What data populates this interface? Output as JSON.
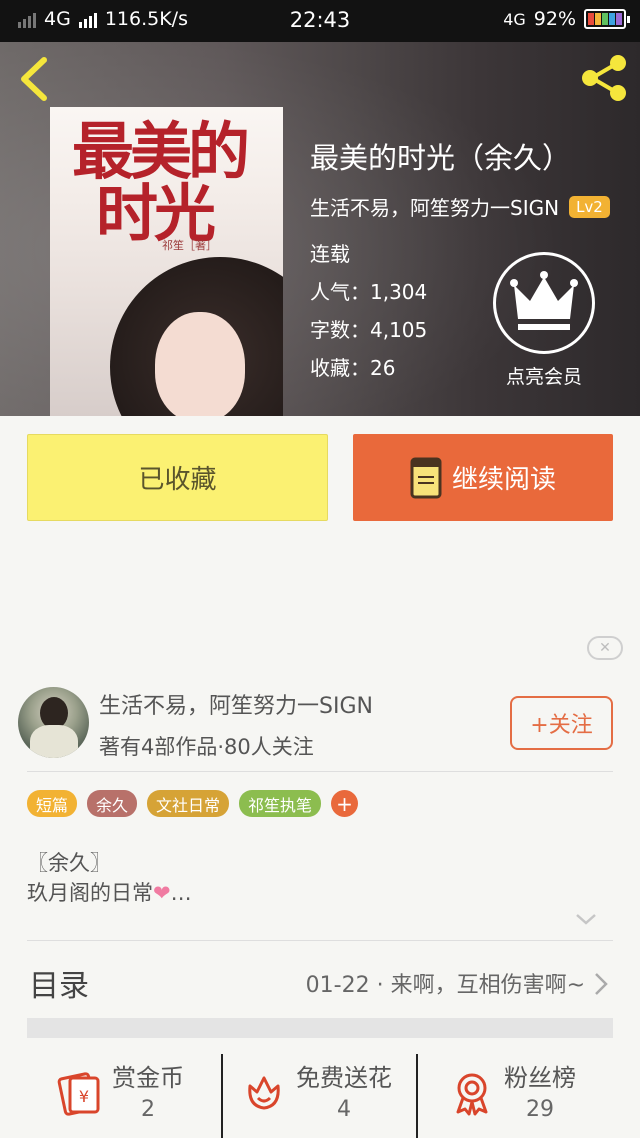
{
  "status_bar": {
    "network": "4G",
    "speed": "116.5K/s",
    "time": "22:43",
    "network_right": "4G",
    "battery": "92%"
  },
  "book": {
    "title": "最美的时光（余久）",
    "author": "生活不易，阿笙努力一SIGN",
    "level": "Lv2",
    "status": "连载",
    "popularity": "人气：1,304",
    "word_count": "字数：4,105",
    "favorites": "收藏：26",
    "cover": {
      "title_line1": "最美的",
      "title_line2": "时光",
      "author": "祁笙［著］"
    }
  },
  "vip": {
    "label": "点亮会员"
  },
  "actions": {
    "favorited_label": "已收藏",
    "continue_label": "继续阅读"
  },
  "author_card": {
    "name": "生活不易，阿笙努力一SIGN",
    "stats": "著有4部作品·80人关注",
    "follow_label": "+关注"
  },
  "tags": [
    {
      "label": "短篇",
      "color": "#f2b233"
    },
    {
      "label": "余久",
      "color": "#b8716a"
    },
    {
      "label": "文社日常",
      "color": "#d6a336"
    },
    {
      "label": "祁笙执笔",
      "color": "#8cbd4f"
    }
  ],
  "description": {
    "line1": "〖余久〗",
    "line2": "玖月阁的日常",
    "ellipsis": "…"
  },
  "toc": {
    "label": "目录",
    "latest": "01-22 · 来啊，互相伤害啊~"
  },
  "bottom_stats": [
    {
      "label": "赏金币",
      "value": "2",
      "icon": "coin-envelope-icon"
    },
    {
      "label": "免费送花",
      "value": "4",
      "icon": "flower-icon"
    },
    {
      "label": "粉丝榜",
      "value": "29",
      "icon": "medal-icon"
    }
  ],
  "colors": {
    "accent_orange": "#e9693b",
    "favorite_yellow": "#fbf172",
    "icon_red": "#d9452b",
    "back_icon_yellow": "#f5e63c"
  }
}
